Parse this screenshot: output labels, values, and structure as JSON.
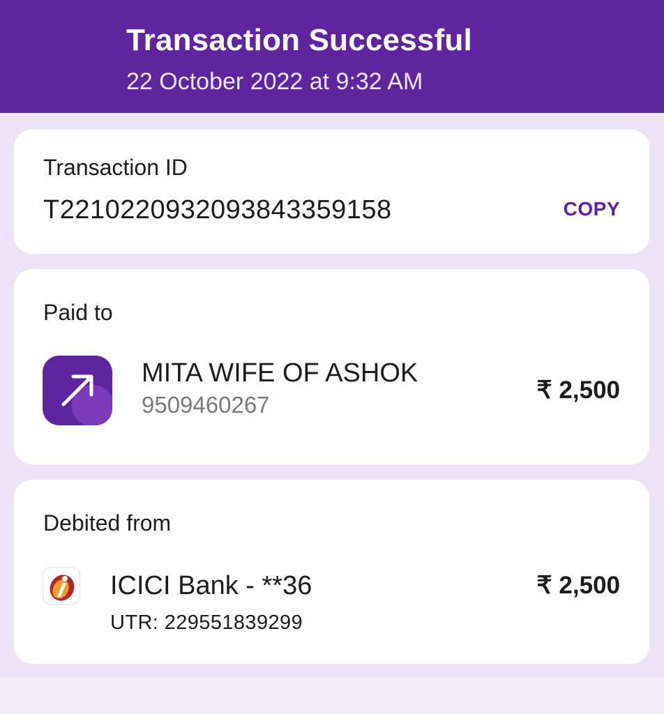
{
  "header": {
    "title": "Transaction Successful",
    "datetime": "22 October 2022 at 9:32 AM"
  },
  "transaction": {
    "label": "Transaction ID",
    "id": "T2210220932093843359158",
    "copy_label": "COPY"
  },
  "paid_to": {
    "label": "Paid to",
    "name": "MITA WIFE OF ASHOK",
    "phone": "9509460267",
    "amount": "₹ 2,500",
    "icon": "arrow-up-right-icon"
  },
  "debited_from": {
    "label": "Debited from",
    "bank": "ICICI Bank - **36",
    "utr": "UTR: 229551839299",
    "amount": "₹ 2,500",
    "icon": "icici-logo-icon"
  },
  "colors": {
    "brand": "#5f259f",
    "background": "#ece3f6",
    "card": "#ffffff"
  }
}
